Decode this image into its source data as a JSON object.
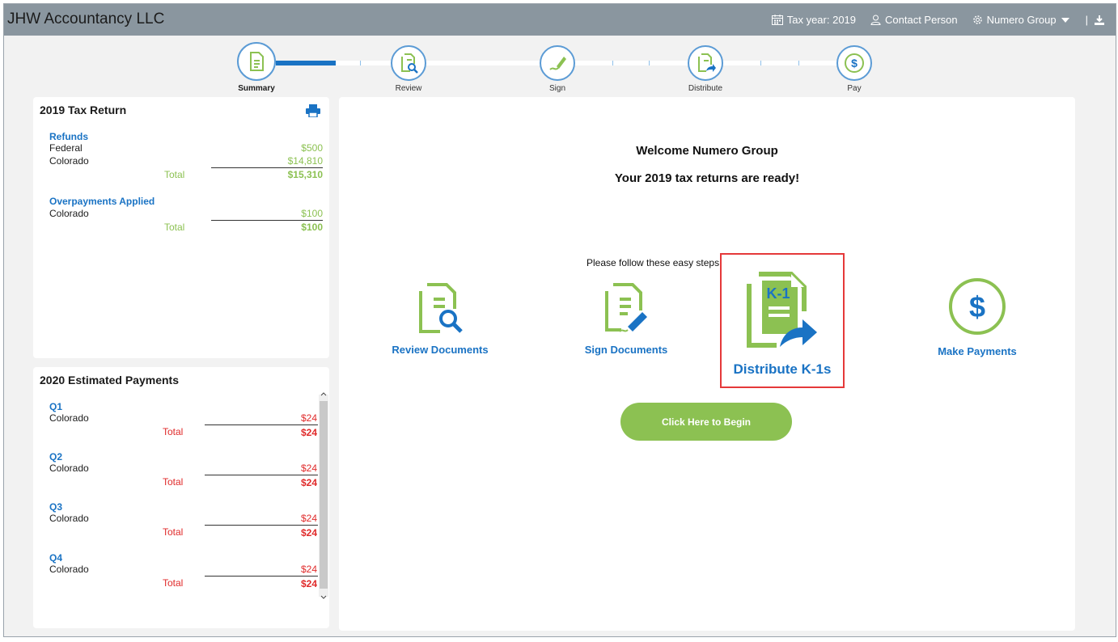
{
  "app": {
    "title": "JHW Accountancy LLC",
    "tax_year": "Tax year: 2019",
    "contact": "Contact Person",
    "org": "Numero Group",
    "separator": "|"
  },
  "steps": [
    {
      "label": "Summary",
      "icon": "summary-doc-icon",
      "active": true
    },
    {
      "label": "Review",
      "icon": "review-doc-icon"
    },
    {
      "label": "Sign",
      "icon": "sign-pen-icon"
    },
    {
      "label": "Distribute",
      "icon": "distribute-k1-icon"
    },
    {
      "label": "Pay",
      "icon": "dollar-icon"
    }
  ],
  "tax_return": {
    "title": "2019 Tax Return",
    "print_icon": "print-icon",
    "refunds": {
      "heading": "Refunds",
      "rows": [
        {
          "label": "Federal",
          "amount": "$500"
        },
        {
          "label": "Colorado",
          "amount": "$14,810"
        }
      ],
      "total_label": "Total",
      "total": "$15,310"
    },
    "overpayments": {
      "heading": "Overpayments Applied",
      "rows": [
        {
          "label": "Colorado",
          "amount": "$100"
        }
      ],
      "total_label": "Total",
      "total": "$100"
    }
  },
  "estimated": {
    "title": "2020 Estimated Payments",
    "quarters": [
      {
        "heading": "Q1",
        "label": "Colorado",
        "amount": "$24",
        "total_label": "Total",
        "total": "$24"
      },
      {
        "heading": "Q2",
        "label": "Colorado",
        "amount": "$24",
        "total_label": "Total",
        "total": "$24"
      },
      {
        "heading": "Q3",
        "label": "Colorado",
        "amount": "$24",
        "total_label": "Total",
        "total": "$24"
      },
      {
        "heading": "Q4",
        "label": "Colorado",
        "amount": "$24",
        "total_label": "Total",
        "total": "$24"
      }
    ]
  },
  "main": {
    "welcome": "Welcome Numero Group",
    "ready": "Your 2019 tax returns are ready!",
    "follow": "Please follow these easy steps s",
    "actions": {
      "review": "Review Documents",
      "sign": "Sign Documents",
      "distribute": "Distribute K-1s",
      "pay": "Make Payments"
    },
    "k1_text": "K-1",
    "dollar": "$",
    "begin": "Click Here to Begin"
  },
  "colors": {
    "header": "#8a969f",
    "accent_blue": "#1a73c4",
    "green": "#8cc152",
    "red": "#e02a2a",
    "highlight": "#e5393a"
  }
}
